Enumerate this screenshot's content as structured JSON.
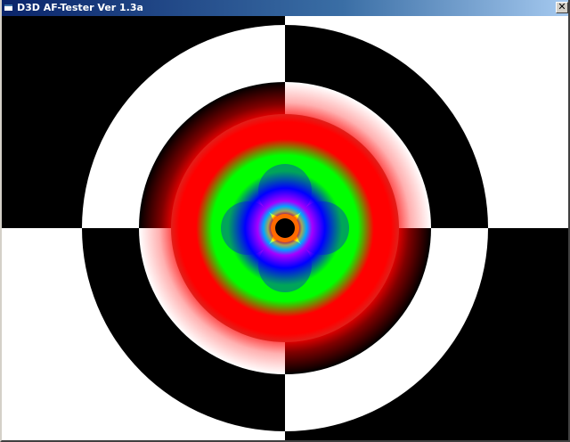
{
  "window": {
    "title": "D3D AF-Tester Ver 1.3a",
    "close_glyph": "✕",
    "title_icon": "app-window-icon"
  },
  "render": {
    "colors": {
      "white": "#ffffff",
      "black": "#000000",
      "red": "#ff0000",
      "green": "#00ff00",
      "blue": "#0000ff",
      "magenta": "#ff00ff",
      "yellow": "#ffff00"
    }
  }
}
